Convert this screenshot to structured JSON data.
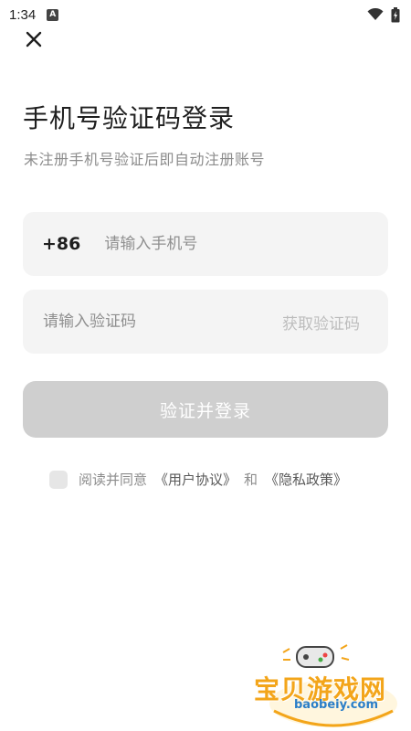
{
  "status_bar": {
    "time": "1:34",
    "a_icon_label": "A",
    "icons": [
      "wifi-icon",
      "battery-icon"
    ]
  },
  "header": {
    "close_icon": "close-icon",
    "title": "手机号验证码登录",
    "subtitle": "未注册手机号验证后即自动注册账号"
  },
  "phone_field": {
    "country_code": "+86",
    "placeholder": "请输入手机号",
    "value": ""
  },
  "code_field": {
    "placeholder": "请输入验证码",
    "value": "",
    "get_code_label": "获取验证码"
  },
  "login_button": {
    "label": "验证并登录"
  },
  "agreement": {
    "prefix": "阅读并同意",
    "user_agreement": "《用户协议》",
    "conjunction": "和",
    "privacy_policy": "《隐私政策》",
    "checked": false
  },
  "watermark": {
    "site_name": "宝贝游戏网",
    "url": "baobeiy.com"
  },
  "colors": {
    "field_bg": "#f4f4f4",
    "button_disabled": "#cfcfcf",
    "muted_text": "#8c8c8c",
    "watermark_orange": "#f3a51a",
    "watermark_blue": "#2b7ec8"
  }
}
